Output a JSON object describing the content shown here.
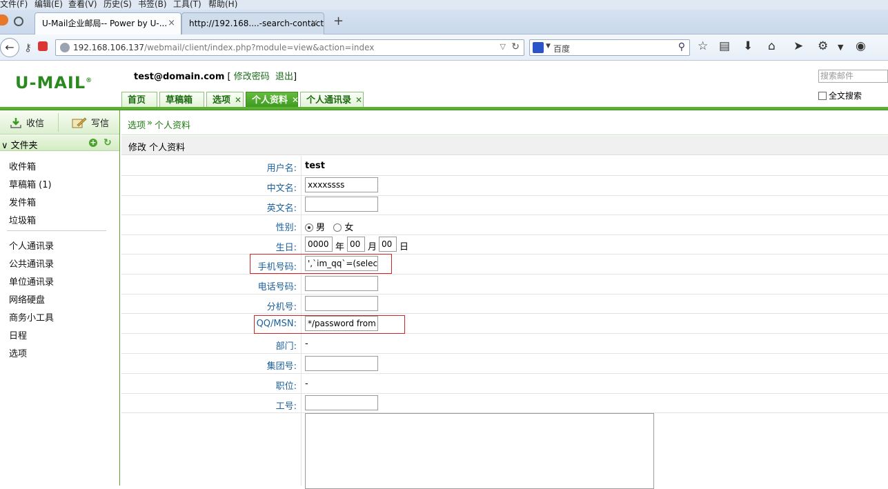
{
  "browser": {
    "menu": [
      "文件(F)",
      "编辑(E)",
      "查看(V)",
      "历史(S)",
      "书签(B)",
      "工具(T)",
      "帮助(H)"
    ],
    "tabs": [
      {
        "title": "U-Mail企业邮局-- Power by U-..."
      },
      {
        "title": "http://192.168....-search-contact"
      }
    ],
    "tab_close": "×",
    "new_tab": "+",
    "url_host": "192.168.106.137",
    "url_path": "/webmail/client/index.php?module=view&action=index",
    "search_placeholder": "百度"
  },
  "header": {
    "logo": "U-MAIL",
    "logo_mark": "®",
    "user_email": "test@domain.com",
    "bracket_open": "[",
    "change_password": "修改密码",
    "logout": "退出",
    "bracket_close": "]",
    "search_placeholder": "搜索邮件",
    "fulltext_label": "全文搜索"
  },
  "app_tabs": [
    {
      "label": "首页",
      "closable": false
    },
    {
      "label": "草稿箱",
      "closable": false
    },
    {
      "label": "选项",
      "closable": true
    },
    {
      "label": "个人资料",
      "closable": true,
      "active": true
    },
    {
      "label": "个人通讯录",
      "closable": true
    }
  ],
  "tab_close_glyph": "✕",
  "sidebar": {
    "receive": "收信",
    "compose": "写信",
    "folder_header": "文件夹",
    "folders": [
      "收件箱",
      "草稿箱 (1)",
      "发件箱",
      "垃圾箱"
    ],
    "tools": [
      "个人通讯录",
      "公共通讯录",
      "单位通讯录",
      "网络硬盘",
      "商务小工具",
      "日程",
      "选项"
    ]
  },
  "breadcrumb": {
    "parent": "选项",
    "sep": "»",
    "current": "个人资料"
  },
  "section_title": "修改 个人资料",
  "form": {
    "username_label": "用户名:",
    "username_value": "test",
    "cn_name_label": "中文名:",
    "cn_name_value": "xxxxssss",
    "en_name_label": "英文名:",
    "en_name_value": "",
    "gender_label": "性别:",
    "gender_male": "男",
    "gender_female": "女",
    "gender_selected": "男",
    "birthday_label": "生日:",
    "birth_year": "0000",
    "year_unit": "年",
    "birth_month": "00",
    "month_unit": "月",
    "birth_day": "00",
    "day_unit": "日",
    "mobile_label": "手机号码:",
    "mobile_value": "',`im_qq`=(select",
    "phone_label": "电话号码:",
    "phone_value": "",
    "ext_label": "分机号:",
    "ext_value": "",
    "qq_label": "QQ/MSN:",
    "qq_value": "*/password from u",
    "dept_label": "部门:",
    "dept_value": "-",
    "group_label": "集团号:",
    "group_value": "",
    "position_label": "职位:",
    "position_value": "-",
    "employee_label": "工号:",
    "employee_value": ""
  },
  "colors": {
    "brand_green": "#2a8a1f",
    "accent_green": "#5cb033",
    "highlight_red": "#d32222",
    "label_blue": "#1a5f9c"
  }
}
